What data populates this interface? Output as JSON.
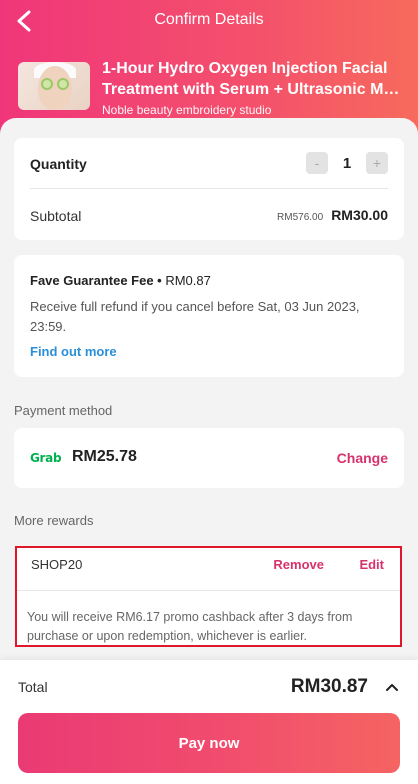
{
  "header": {
    "title": "Confirm Details",
    "back_icon": "chevron-left-icon"
  },
  "service": {
    "title_line1": "1-Hour Hydro Oxygen Injection Facial",
    "title_line2": "Treatment with Serum + Ultrasonic Ma...",
    "merchant": "Noble beauty embroidery studio"
  },
  "quantity": {
    "label": "Quantity",
    "minus": "-",
    "value": "1",
    "plus": "+"
  },
  "subtotal": {
    "label": "Subtotal",
    "original_price": "RM576.00",
    "price": "RM30.00"
  },
  "fee": {
    "title": "Fave Guarantee Fee",
    "amount": "RM0.87",
    "description": "Receive full refund if you cancel before Sat, 03 Jun 2023, 23:59.",
    "link": "Find out more"
  },
  "payment": {
    "section_label": "Payment method",
    "provider_logo_text": "Grab",
    "amount": "RM25.78",
    "change_label": "Change"
  },
  "rewards": {
    "section_label": "More rewards",
    "code": "SHOP20",
    "remove_label": "Remove",
    "edit_label": "Edit",
    "description": "You will receive RM6.17 promo cashback after 3 days from purchase or upon redemption, whichever is earlier."
  },
  "footer": {
    "total_label": "Total",
    "total_amount": "RM30.87",
    "pay_label": "Pay now"
  },
  "colors": {
    "accent": "#d6336c",
    "link": "#2a8fd9",
    "grab": "#00b14f",
    "highlight_border": "#e0162b"
  }
}
